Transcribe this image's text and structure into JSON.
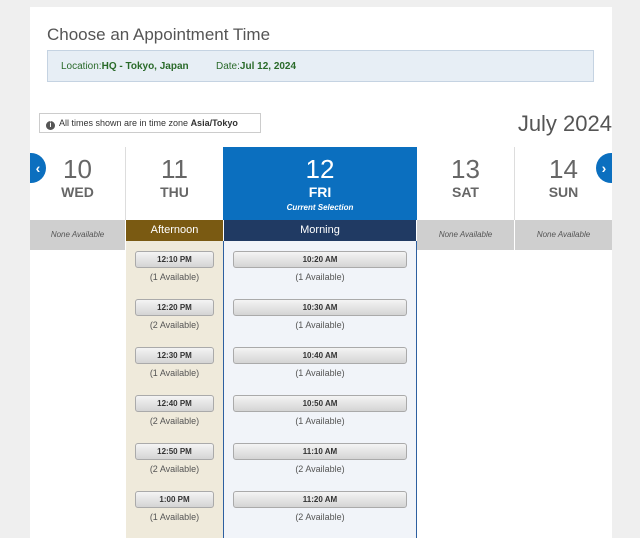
{
  "title": "Choose an Appointment Time",
  "info": {
    "location_label": "Location:",
    "location_value": "HQ - Tokyo, Japan",
    "date_label": "Date:",
    "date_value": "Jul 12, 2024"
  },
  "timezone": {
    "prefix": "All times shown are in time zone ",
    "zone": "Asia/Tokyo"
  },
  "month_label": "July 2024",
  "days": [
    {
      "num": "10",
      "dow": "WED",
      "none_text": "None Available"
    },
    {
      "num": "11",
      "dow": "THU",
      "section": "Afternoon"
    },
    {
      "num": "12",
      "dow": "FRI",
      "note": "Current Selection",
      "section": "Morning"
    },
    {
      "num": "13",
      "dow": "SAT",
      "none_text": "None Available"
    },
    {
      "num": "14",
      "dow": "SUN",
      "none_text": "None Available"
    }
  ],
  "thu_slots": [
    {
      "time": "12:10 PM",
      "avail": "(1 Available)"
    },
    {
      "time": "12:20 PM",
      "avail": "(2 Available)"
    },
    {
      "time": "12:30 PM",
      "avail": "(1 Available)"
    },
    {
      "time": "12:40 PM",
      "avail": "(2 Available)"
    },
    {
      "time": "12:50 PM",
      "avail": "(2 Available)"
    },
    {
      "time": "1:00 PM",
      "avail": "(1 Available)"
    }
  ],
  "fri_slots": [
    {
      "time": "10:20 AM",
      "avail": "(1 Available)"
    },
    {
      "time": "10:30 AM",
      "avail": "(1 Available)"
    },
    {
      "time": "10:40 AM",
      "avail": "(1 Available)"
    },
    {
      "time": "10:50 AM",
      "avail": "(1 Available)"
    },
    {
      "time": "11:10 AM",
      "avail": "(2 Available)"
    },
    {
      "time": "11:20 AM",
      "avail": "(2 Available)"
    }
  ],
  "icons": {
    "prev": "chevron-left-icon",
    "next": "chevron-right-icon",
    "info": "info-icon"
  },
  "colors": {
    "accent": "#0b6fbf",
    "afternoon": "#7a5a12",
    "morning": "#203a63"
  }
}
